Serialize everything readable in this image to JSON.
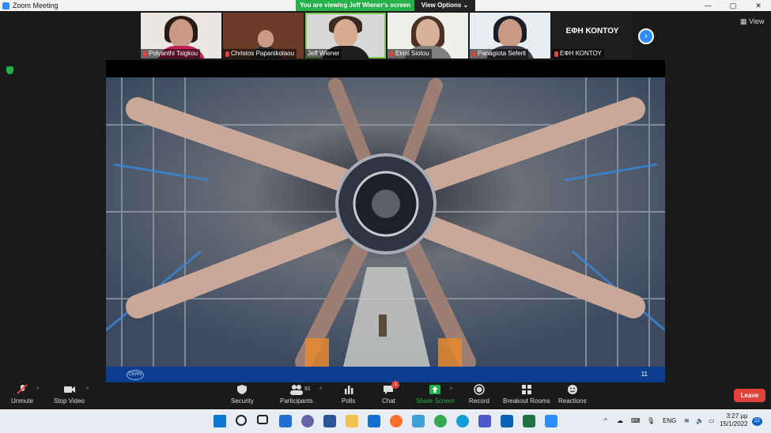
{
  "window": {
    "title": "Zoom Meeting",
    "minimize": "—",
    "maximize": "▢",
    "close": "✕"
  },
  "share_banner": {
    "message": "You are viewing Jeff Wiener's screen",
    "options_label": "View Options ⌄"
  },
  "gallery": {
    "participants": [
      {
        "name": "Polyanthi Tsigkou",
        "muted": true
      },
      {
        "name": "Christos Papanikolaou",
        "muted": true
      },
      {
        "name": "Jeff Wiener",
        "muted": false
      },
      {
        "name": "Eirini Siotou",
        "muted": true
      },
      {
        "name": "Panagiota Seferli",
        "muted": true
      },
      {
        "name": "ΕΦΗ ΚΟΝΤΟΥ",
        "muted": true,
        "display_text": "ΕΦΗ ΚΟΝΤΟΥ"
      }
    ],
    "next_label": "›",
    "view_label": "View"
  },
  "shared_screen": {
    "footer_logo": "CERN",
    "page_number": "11"
  },
  "toolbar": {
    "unmute": "Unmute",
    "stop_video": "Stop Video",
    "security": "Security",
    "participants": "Participants",
    "participants_count": "91",
    "polls": "Polls",
    "chat": "Chat",
    "chat_badge": "1",
    "share_screen": "Share Screen",
    "record": "Record",
    "breakout_rooms": "Breakout Rooms",
    "reactions": "Reactions",
    "leave": "Leave"
  },
  "taskbar": {
    "language": "ENG",
    "time": "3:27 μμ",
    "date": "15/1/2022",
    "notifications": "22",
    "apps": [
      "windows-start",
      "search",
      "task-view",
      "widgets",
      "teams-chat",
      "word",
      "file-explorer",
      "mail",
      "firefox",
      "sticky",
      "chrome",
      "edge",
      "teams",
      "outlook",
      "excel",
      "zoom"
    ]
  },
  "colors": {
    "accent": "#2d8cff",
    "share_green": "#26b24a",
    "leave_red": "#e0413b",
    "slide_footer": "#0b3e8e"
  }
}
